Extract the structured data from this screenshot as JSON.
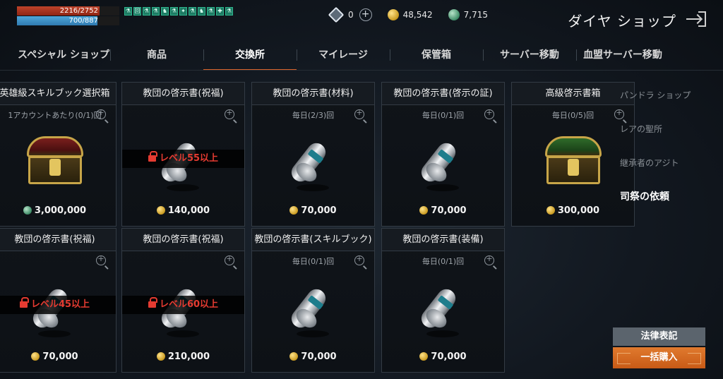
{
  "status": {
    "hp": "2216/2752",
    "hp_fraction": 0.805,
    "mp": "700/887",
    "mp_fraction": 0.789,
    "buffs": [
      "⚗",
      "回",
      "⚗",
      "⚗",
      "♞",
      "⚗",
      "✦",
      "⚗",
      "♞",
      "⚗",
      "✚",
      "⚗"
    ]
  },
  "currencies": {
    "diamond": "0",
    "gold": "48,542",
    "green": "7,715"
  },
  "shop_title": "ダイヤ ショップ",
  "tabs": [
    "スペシャル ショップ",
    "商品",
    "交換所",
    "マイレージ",
    "保管箱",
    "サーバー移動",
    "血盟サーバー移動"
  ],
  "active_tab": 2,
  "items": [
    {
      "title": "英雄級スキルブック選択箱",
      "limit": "1アカウントあたり(0/1)回",
      "art": "chest-red",
      "lock": "",
      "currency": "green",
      "price": "3,000,000"
    },
    {
      "title": "教団の啓示書(祝福)",
      "limit": "",
      "art": "scroll",
      "lock": "レベル55以上",
      "currency": "gold",
      "price": "140,000"
    },
    {
      "title": "教団の啓示書(材料)",
      "limit": "毎日(2/3)回",
      "art": "scroll",
      "lock": "",
      "currency": "gold",
      "price": "70,000"
    },
    {
      "title": "教団の啓示書(啓示の証)",
      "limit": "毎日(0/1)回",
      "art": "scroll",
      "lock": "",
      "currency": "gold",
      "price": "70,000"
    },
    {
      "title": "高級啓示書箱",
      "limit": "毎日(0/5)回",
      "art": "chest-green",
      "lock": "",
      "currency": "gold",
      "price": "300,000"
    },
    {
      "title": "教団の啓示書(祝福)",
      "limit": "",
      "art": "scroll",
      "lock": "レベル45以上",
      "currency": "gold",
      "price": "70,000"
    },
    {
      "title": "教団の啓示書(祝福)",
      "limit": "",
      "art": "scroll",
      "lock": "レベル60以上",
      "currency": "gold",
      "price": "210,000"
    },
    {
      "title": "教団の啓示書(スキルブック)",
      "limit": "毎日(0/1)回",
      "art": "scroll",
      "lock": "",
      "currency": "gold",
      "price": "70,000"
    },
    {
      "title": "教団の啓示書(装備)",
      "limit": "毎日(0/1)回",
      "art": "scroll",
      "lock": "",
      "currency": "gold",
      "price": "70,000"
    }
  ],
  "sidebar": {
    "items": [
      "パンドラ ショップ",
      "レアの聖所",
      "継承者のアジト",
      "司祭の依頼"
    ],
    "active": 3
  },
  "buttons": {
    "legal": "法律表記",
    "buy_all": "一括購入"
  }
}
